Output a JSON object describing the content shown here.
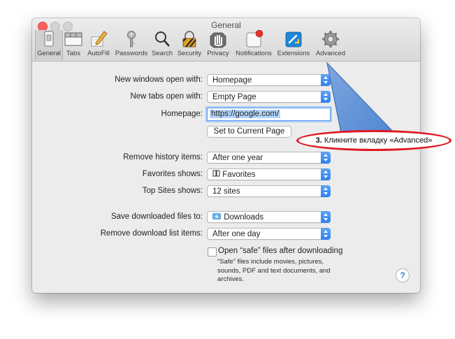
{
  "window": {
    "title": "General"
  },
  "tabs": [
    {
      "label": "General",
      "icon": "general-switch-icon"
    },
    {
      "label": "Tabs",
      "icon": "tabs-icon"
    },
    {
      "label": "AutoFill",
      "icon": "autofill-pencil-icon"
    },
    {
      "label": "Passwords",
      "icon": "key-icon"
    },
    {
      "label": "Search",
      "icon": "magnifier-icon"
    },
    {
      "label": "Security",
      "icon": "lock-icon"
    },
    {
      "label": "Privacy",
      "icon": "hand-icon"
    },
    {
      "label": "Notifications",
      "icon": "notification-badge-icon"
    },
    {
      "label": "Extensions",
      "icon": "puzzle-extensions-icon"
    },
    {
      "label": "Advanced",
      "icon": "gear-icon"
    }
  ],
  "settings": {
    "new_windows": {
      "label": "New windows open with:",
      "value": "Homepage"
    },
    "new_tabs": {
      "label": "New tabs open with:",
      "value": "Empty Page"
    },
    "homepage": {
      "label": "Homepage:",
      "value": "https://google.com/"
    },
    "set_current_label": "Set to Current Page",
    "remove_history": {
      "label": "Remove history items:",
      "value": "After one year"
    },
    "favorites_shows": {
      "label": "Favorites shows:",
      "value": "Favorites",
      "icon": "book-icon"
    },
    "top_sites": {
      "label": "Top Sites shows:",
      "value": "12 sites"
    },
    "save_downloads": {
      "label": "Save downloaded files to:",
      "value": "Downloads",
      "icon": "downloads-folder-icon"
    },
    "remove_download_list": {
      "label": "Remove download list items:",
      "value": "After one day"
    },
    "open_safe_files": {
      "label": "Open “safe” files after downloading",
      "checked": false
    },
    "safe_note": [
      "“Safe” files include movies, pictures,",
      "sounds, PDF and text documents, and",
      "archives."
    ]
  },
  "help": {
    "label": "?"
  },
  "callout": {
    "step": "3.",
    "text": "Кликните вкладку «Advanced»"
  },
  "colors": {
    "accent": "#2d7ff2",
    "callout_border": "#e0181f",
    "arrow": "#5b8fd6",
    "close": "#fc605c"
  }
}
